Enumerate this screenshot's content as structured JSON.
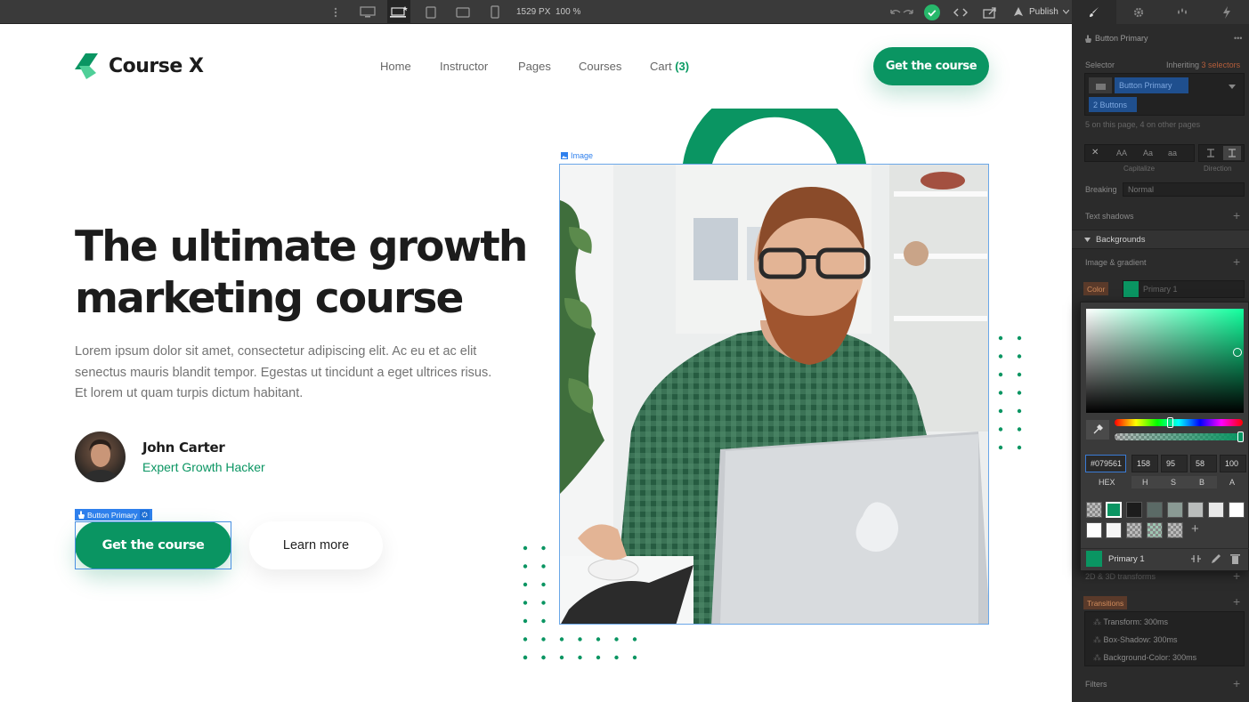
{
  "toolbar": {
    "width_value": "1529",
    "width_unit": "PX",
    "zoom": "100 %",
    "publish_label": "Publish"
  },
  "nav": {
    "logo_text": "Course X",
    "items": [
      "Home",
      "Instructor",
      "Pages",
      "Courses"
    ],
    "cart_label": "Cart",
    "cart_count": "(3)",
    "cta_label": "Get the course"
  },
  "hero": {
    "title_line1": "The ultimate growth",
    "title_line2": "marketing course",
    "text": "Lorem ipsum dolor sit amet, consectetur adipiscing elit. Ac eu et ac elit senectus mauris blandit tempor. Egestas ut tincidunt a eget ultrices risus. Et lorem ut quam turpis dictum habitant.",
    "author_name": "John Carter",
    "author_role": "Expert Growth Hacker",
    "primary_button": "Get the course",
    "secondary_button": "Learn more",
    "selection_tag": "Button Primary",
    "image_tag": "Image"
  },
  "panel": {
    "element_name": "Button Primary",
    "selector_label": "Selector",
    "inheriting_label": "Inheriting",
    "inheriting_count": "3 selectors",
    "selector_chip": "Button Primary",
    "combo_chip": "2 Buttons",
    "usage_note": "5 on this page, 4 on other pages",
    "capitalize_label": "Capitalize",
    "direction_label": "Direction",
    "breaking_label": "Breaking",
    "breaking_value": "Normal",
    "text_shadows_label": "Text shadows",
    "backgrounds_section": "Backgrounds",
    "image_gradient_label": "Image & gradient",
    "color_label": "Color",
    "color_value": "Primary 1",
    "transforms_label": "2D & 3D transforms",
    "transitions_label": "Transitions",
    "transitions": [
      "Transform: 300ms",
      "Box-Shadow: 300ms",
      "Background-Color: 300ms"
    ],
    "filters_label": "Filters"
  },
  "picker": {
    "hex": "#079561",
    "h": "158",
    "s": "95",
    "b": "58",
    "a": "100",
    "labels": [
      "HEX",
      "H",
      "S",
      "B",
      "A"
    ],
    "swatch_name": "Primary 1"
  },
  "colors": {
    "brand": "#0a9562",
    "toolbar": "#3a3a3a",
    "panel": "#2b2b2b"
  }
}
